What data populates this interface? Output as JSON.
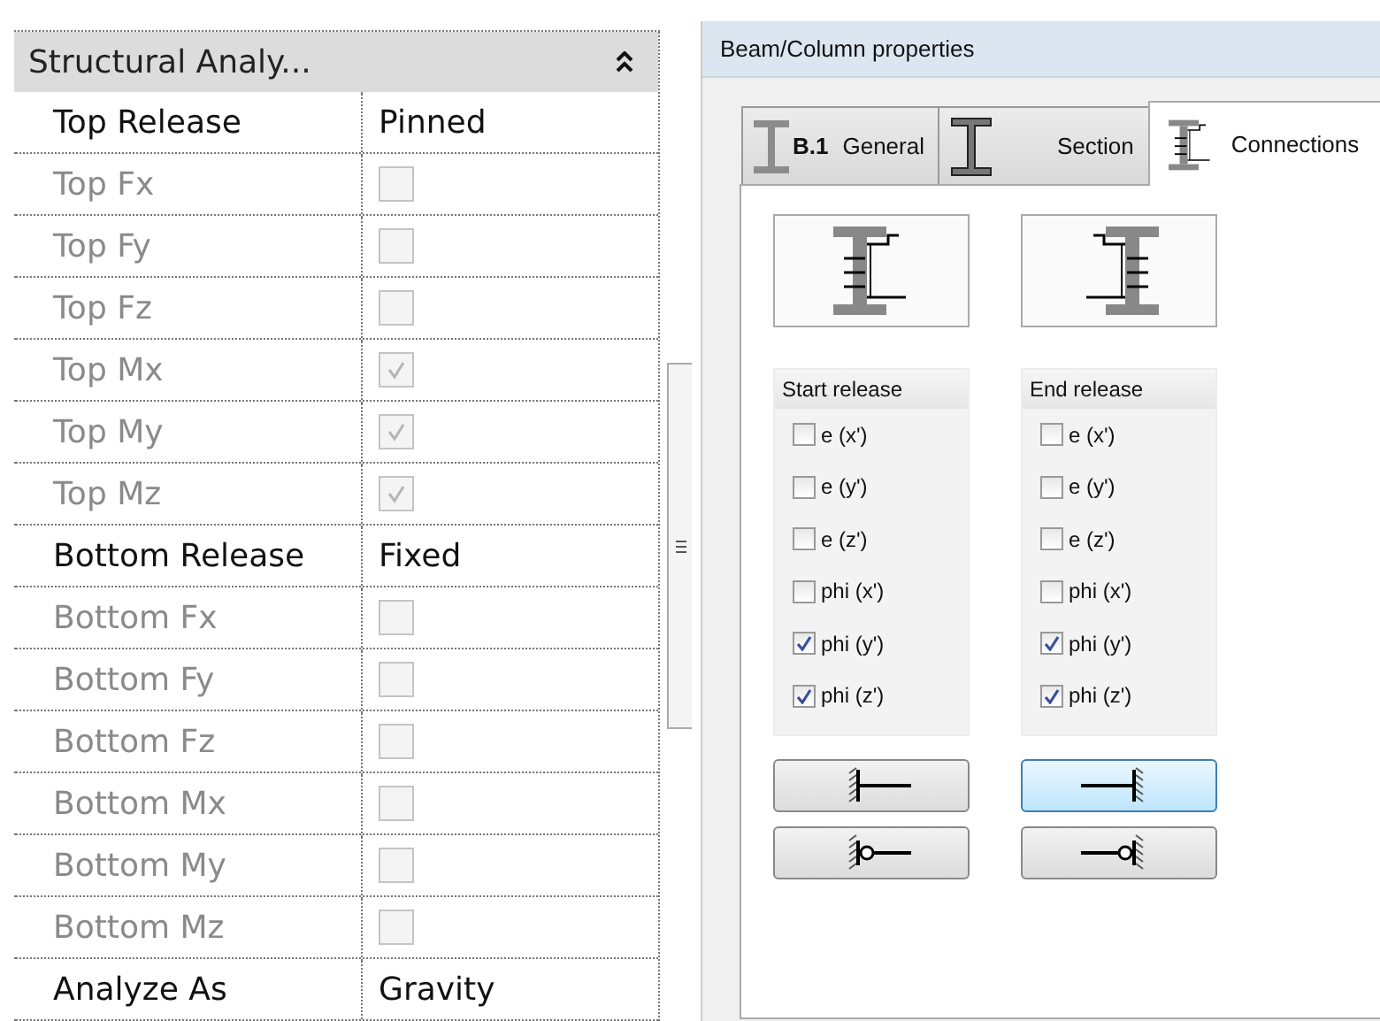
{
  "properties": {
    "group_title": "Structural Analy...",
    "rows": [
      {
        "label": "Top Release",
        "kind": "value",
        "value": "Pinned",
        "disabled": false
      },
      {
        "label": "Top Fx",
        "kind": "checkbox",
        "checked": false,
        "disabled": true
      },
      {
        "label": "Top Fy",
        "kind": "checkbox",
        "checked": false,
        "disabled": true
      },
      {
        "label": "Top Fz",
        "kind": "checkbox",
        "checked": false,
        "disabled": true
      },
      {
        "label": "Top Mx",
        "kind": "checkbox",
        "checked": true,
        "disabled": true
      },
      {
        "label": "Top My",
        "kind": "checkbox",
        "checked": true,
        "disabled": true
      },
      {
        "label": "Top Mz",
        "kind": "checkbox",
        "checked": true,
        "disabled": true
      },
      {
        "label": "Bottom Release",
        "kind": "value",
        "value": "Fixed",
        "disabled": false
      },
      {
        "label": "Bottom Fx",
        "kind": "checkbox",
        "checked": false,
        "disabled": true
      },
      {
        "label": "Bottom Fy",
        "kind": "checkbox",
        "checked": false,
        "disabled": true
      },
      {
        "label": "Bottom Fz",
        "kind": "checkbox",
        "checked": false,
        "disabled": true
      },
      {
        "label": "Bottom Mx",
        "kind": "checkbox",
        "checked": false,
        "disabled": true
      },
      {
        "label": "Bottom My",
        "kind": "checkbox",
        "checked": false,
        "disabled": true
      },
      {
        "label": "Bottom Mz",
        "kind": "checkbox",
        "checked": false,
        "disabled": true
      },
      {
        "label": "Analyze As",
        "kind": "value",
        "value": "Gravity",
        "disabled": false
      }
    ]
  },
  "dialog": {
    "title": "Beam/Column properties",
    "tabs": [
      {
        "label": "General",
        "badge": "B.1",
        "kind": "general",
        "selected": false
      },
      {
        "label": "Section",
        "kind": "section",
        "selected": false
      },
      {
        "label": "Connections",
        "kind": "connections",
        "selected": true
      }
    ],
    "releases": [
      {
        "title": "Start release",
        "kind": "start",
        "options": [
          {
            "label": "e (x')",
            "checked": false
          },
          {
            "label": "e (y')",
            "checked": false
          },
          {
            "label": "e (z')",
            "checked": false
          },
          {
            "label": "phi (x')",
            "checked": false
          },
          {
            "label": "phi (y')",
            "checked": true
          },
          {
            "label": "phi (z')",
            "checked": true
          }
        ],
        "buttons": [
          {
            "kind": "fixed",
            "selected": false
          },
          {
            "kind": "pinned",
            "selected": false
          }
        ]
      },
      {
        "title": "End release",
        "kind": "end",
        "options": [
          {
            "label": "e (x')",
            "checked": false
          },
          {
            "label": "e (y')",
            "checked": false
          },
          {
            "label": "e (z')",
            "checked": false
          },
          {
            "label": "phi (x')",
            "checked": false
          },
          {
            "label": "phi (y')",
            "checked": true
          },
          {
            "label": "phi (z')",
            "checked": true
          }
        ],
        "buttons": [
          {
            "kind": "fixed",
            "selected": true
          },
          {
            "kind": "pinned",
            "selected": false
          }
        ]
      }
    ]
  }
}
